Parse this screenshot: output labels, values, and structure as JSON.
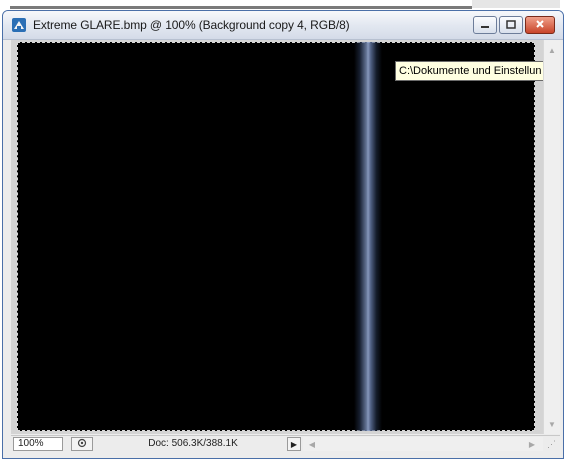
{
  "window": {
    "title": "Extreme GLARE.bmp @ 100% (Background copy 4, RGB/8)"
  },
  "tooltip": {
    "text": "C:\\Dokumente und Einstellun"
  },
  "statusbar": {
    "zoom": "100%",
    "doc_info": "Doc: 506.3K/388.1K"
  },
  "icons": {
    "app": "photoshop-document-icon",
    "minimize": "minimize-icon",
    "maximize": "maximize-icon",
    "close": "close-icon",
    "status_menu": "triangle-right-icon"
  }
}
